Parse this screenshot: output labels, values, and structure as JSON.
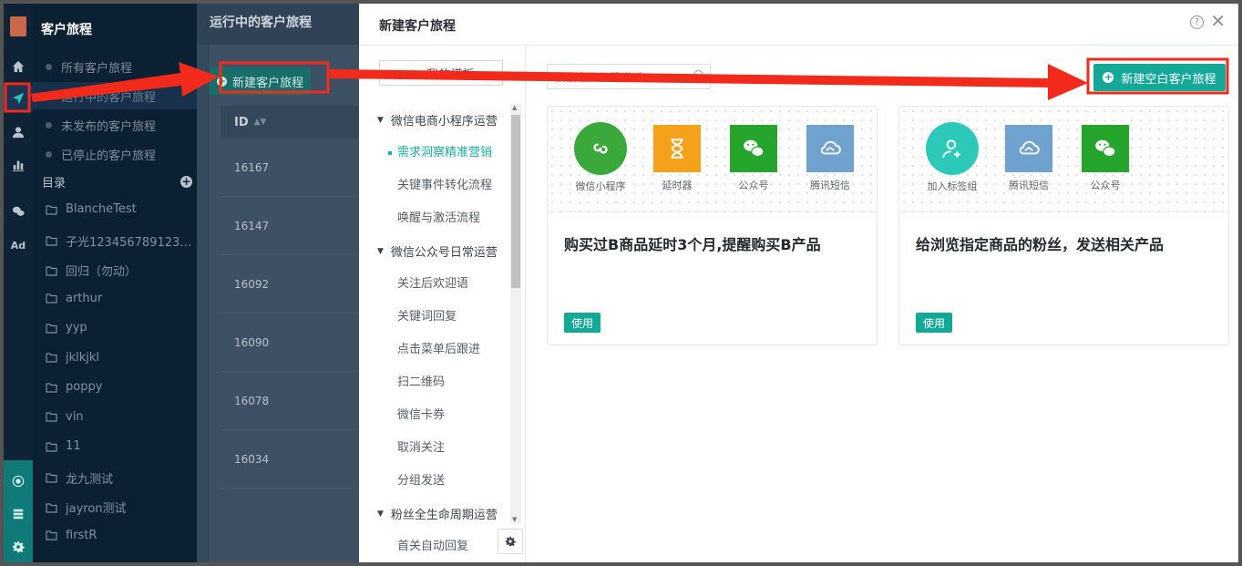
{
  "sidebar": {
    "title": "客户旅程",
    "items": [
      {
        "label": "所有客户旅程"
      },
      {
        "label": "运行中的客户旅程"
      },
      {
        "label": "未发布的客户旅程"
      },
      {
        "label": "已停止的客户旅程"
      }
    ],
    "dir_label": "目录",
    "folders": [
      "BlancheTest",
      "子光1234567891234567...",
      "回归（勿动）",
      "arthur",
      "yyp",
      "jklkjkl",
      "poppy",
      "vin",
      "11",
      "龙九测试",
      "jayron测试",
      "firstR"
    ]
  },
  "rail": {
    "icons": [
      "home-icon",
      "send-icon",
      "user-icon",
      "chart-icon",
      "wechat-icon",
      "ad-icon"
    ],
    "ad_label": "Ad",
    "bottom_icons": [
      "hub-icon",
      "server-icon",
      "settings-icon"
    ]
  },
  "list": {
    "title": "运行中的客户旅程",
    "new_button": "新建客户旅程",
    "id_header": "ID",
    "rows": [
      "16167",
      "16147",
      "16092",
      "16090",
      "16078",
      "16034"
    ]
  },
  "modal": {
    "title": "新建客户旅程",
    "my_templates": "我的模板",
    "categories": [
      {
        "label": "微信电商小程序运营",
        "subs": [
          "需求洞察精准营销",
          "关键事件转化流程",
          "唤醒与激活流程"
        ]
      },
      {
        "label": "微信公众号日常运营",
        "subs": [
          "关注后欢迎语",
          "关键词回复",
          "点击菜单后跟进",
          "扫二维码",
          "微信卡券",
          "取消关注",
          "分组发送"
        ]
      },
      {
        "label": "粉丝全生命周期运营",
        "subs": [
          "首关自动回复"
        ]
      }
    ],
    "search_placeholder": "搜索客户旅程模板",
    "blank_button": "新建空白客户旅程",
    "use_label": "使用",
    "cards": [
      {
        "title": "购买过B商品延时3个月,提醒购买B产品",
        "nodes": [
          {
            "label": "微信小程序",
            "icon": "mini-program-icon",
            "color": "#3aa83a"
          },
          {
            "label": "延时器",
            "icon": "hourglass-icon",
            "color": "#f5a21a"
          },
          {
            "label": "公众号",
            "icon": "wechat-icon",
            "color": "#26a52d"
          },
          {
            "label": "腾讯短信",
            "icon": "cloud-icon",
            "color": "#6fa2cf"
          }
        ]
      },
      {
        "title": "给浏览指定商品的粉丝，发送相关产品",
        "nodes": [
          {
            "label": "加入标签组",
            "icon": "add-user-icon",
            "color": "#2cc9b9"
          },
          {
            "label": "腾讯短信",
            "icon": "cloud-icon",
            "color": "#6fa2cf"
          },
          {
            "label": "公众号",
            "icon": "wechat-icon",
            "color": "#26a52d"
          }
        ]
      }
    ]
  },
  "colors": {
    "accent": "#14a898",
    "highlight": "#f22a1c",
    "sidebar_bg": "#0c2034"
  }
}
